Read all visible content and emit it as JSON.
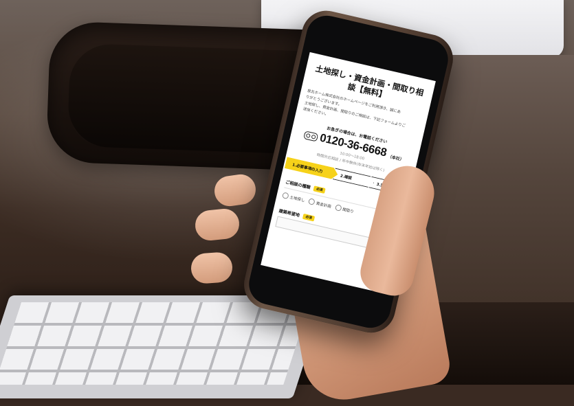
{
  "form": {
    "title": "土地探し・資金計画・間取り相談【無料】",
    "intro_lines": [
      "泉北ホーム株式会社のホームページをご利用頂き、誠にあ",
      "りがとうございます。",
      "土地探し、資金計画、間取りのご相談は、下記フォームよりご",
      "送信ください。"
    ],
    "contact": {
      "urgent_label": "お急ぎの場合は、お電話ください",
      "phone_number": "0120-36-6668",
      "office": "（本社）",
      "hours": "10:00〜18:00",
      "hours_note": "時間外応相談 / 年中無休(年末年始は除く)"
    },
    "steps": [
      {
        "label": "1.必要事項の入力",
        "active": true
      },
      {
        "label": "2.確認",
        "active": false
      },
      {
        "label": "3.完了",
        "active": false
      }
    ],
    "consultation": {
      "label": "ご相談の種類",
      "required": "必須",
      "options": [
        "土地探し",
        "資金計画",
        "間取り"
      ]
    },
    "location": {
      "label": "建築希望地",
      "required": "必須"
    }
  },
  "colors": {
    "accent": "#f6d21a",
    "text": "#111111"
  }
}
